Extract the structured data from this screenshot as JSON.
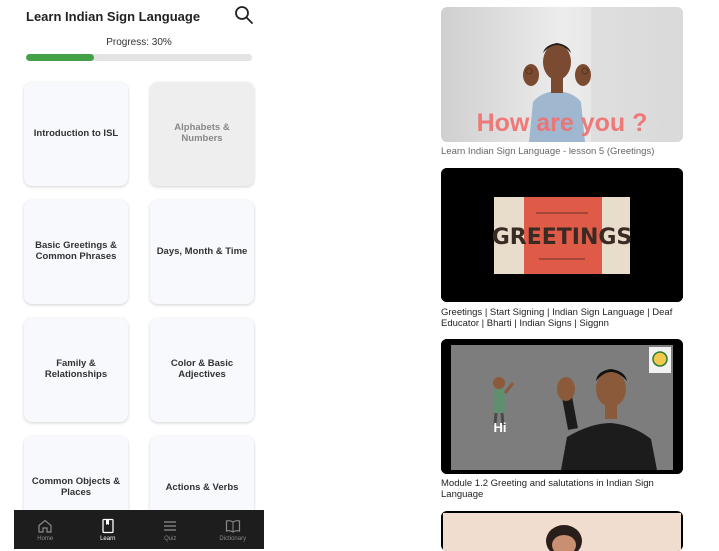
{
  "app": {
    "title": "Learn Indian Sign Language",
    "progress_label": "Progress: 30%",
    "progress_fraction": 0.3,
    "accent_color": "#43a047"
  },
  "lessons": [
    {
      "label": "Introduction to ISL",
      "locked": false
    },
    {
      "label": "Alphabets & Numbers",
      "locked": true
    },
    {
      "label": "Basic Greetings & Common Phrases",
      "locked": false
    },
    {
      "label": "Days, Month & Time",
      "locked": false
    },
    {
      "label": "Family & Relationships",
      "locked": false
    },
    {
      "label": "Color & Basic Adjectives",
      "locked": false
    },
    {
      "label": "Common Objects & Places",
      "locked": false
    },
    {
      "label": "Actions & Verbs",
      "locked": false
    }
  ],
  "nav": [
    {
      "label": "Home",
      "icon": "home-icon",
      "active": false
    },
    {
      "label": "Learn",
      "icon": "book-icon",
      "active": true
    },
    {
      "label": "Quiz",
      "icon": "list-icon",
      "active": false
    },
    {
      "label": "Dictionary",
      "icon": "open-book-icon",
      "active": false
    }
  ],
  "videos": [
    {
      "overlay_text": "How are you ?",
      "caption": "Learn Indian Sign Language - lesson 5 (Greetings)"
    },
    {
      "overlay_text": "GREETINGS",
      "caption": "Greetings | Start Signing | Indian Sign Language | Deaf Educator | Bharti  | Indian Signs | Siggnn"
    },
    {
      "overlay_text": "Hi",
      "caption": "Module 1.2 Greeting and salutations in Indian Sign Language"
    }
  ]
}
